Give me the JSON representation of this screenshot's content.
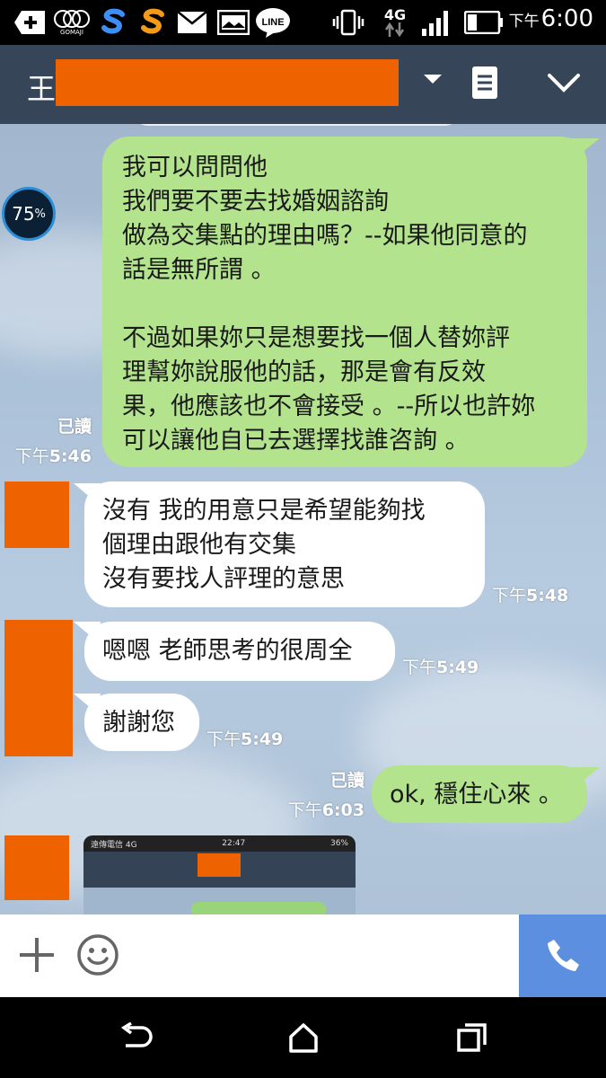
{
  "status_bar": {
    "network_type": "4G",
    "time_ampm": "下午",
    "time": "6:00",
    "icons": [
      "add-box-icon",
      "gomaji-app-icon",
      "s-app-blue-icon",
      "s-app-orange-icon",
      "mail-icon",
      "image-icon",
      "line-app-icon",
      "vibrate-icon",
      "network-4g-icon",
      "signal-icon",
      "battery-icon"
    ],
    "gomaji_label": "GOMAJI",
    "line_label": "LINE"
  },
  "header": {
    "contact_name_visible": "王",
    "dropdown_icon": "caret-down-icon",
    "notes_icon": "notes-icon",
    "menu_icon": "chevron-down-icon"
  },
  "progress_badge": {
    "value": "75",
    "unit": "%"
  },
  "messages": [
    {
      "side": "right",
      "read_label": "已讀",
      "time_ampm": "下午",
      "time": "5:46",
      "lines": [
        "我可以問問他",
        "我們要不要去找婚姻諮詢",
        "做為交集點的理由嗎？--如果他同意的",
        "話是無所謂 。",
        "",
        "不過如果妳只是想要找一個人替妳評",
        "理幫妳說服他的話，那是會有反效",
        "果，他應該也不會接受 。--所以也許妳",
        "可以讓他自已去選擇找誰咨詢 。"
      ]
    },
    {
      "side": "left",
      "time_ampm": "下午",
      "time": "5:48",
      "lines": [
        "沒有 我的用意只是希望能夠找",
        "個理由跟他有交集",
        "沒有要找人評理的意思"
      ]
    },
    {
      "side": "left",
      "time_ampm": "下午",
      "time": "5:49",
      "lines": [
        "嗯嗯 老師思考的很周全"
      ]
    },
    {
      "side": "left",
      "time_ampm": "下午",
      "time": "5:49",
      "lines": [
        "謝謝您"
      ]
    },
    {
      "side": "right",
      "read_label": "已讀",
      "time_ampm": "下午",
      "time": "6:03",
      "lines": [
        "ok, 穩住心來 。"
      ]
    }
  ],
  "thumbnail": {
    "status_time": "22:47",
    "status_left": "遠傳電信 4G",
    "status_right": "36%"
  },
  "input_bar": {
    "plus_icon": "plus-icon",
    "emoji_icon": "emoji-icon",
    "call_icon": "phone-icon"
  },
  "nav_bar": {
    "icons": [
      "back-icon",
      "home-icon",
      "recents-icon"
    ]
  },
  "colors": {
    "header_bg": "#364658",
    "bubble_green": "#b3e38d",
    "redaction": "#ee6300",
    "call_button": "#5d8fe0"
  }
}
